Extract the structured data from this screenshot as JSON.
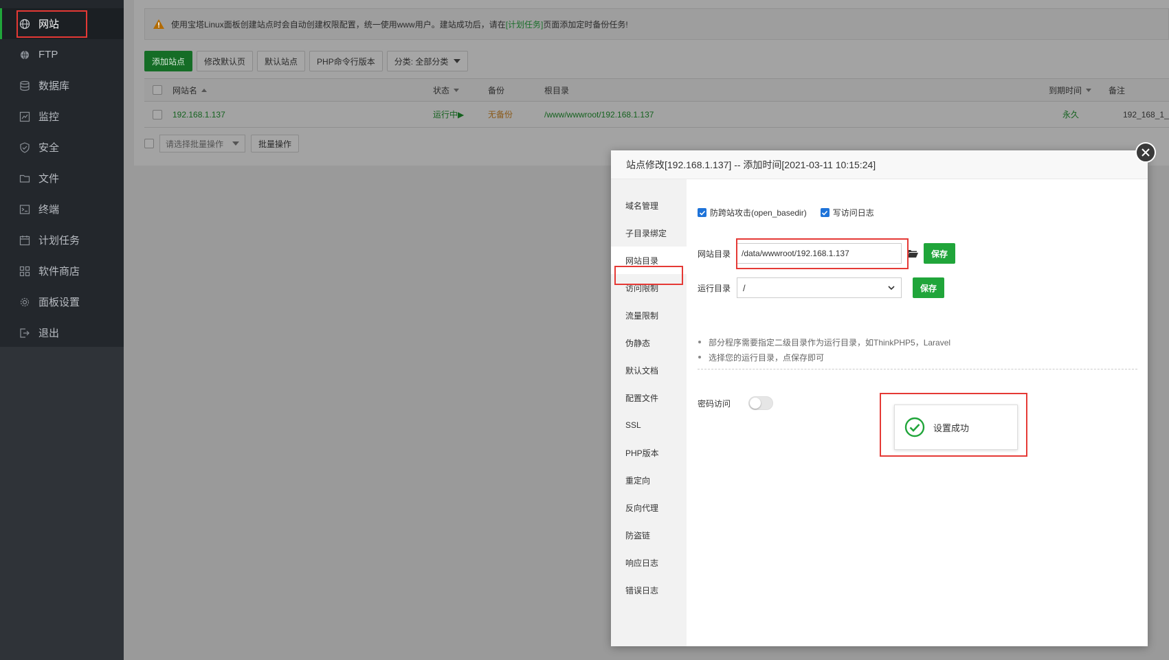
{
  "sidebar": {
    "items": [
      {
        "label": "网站",
        "icon": "globe-icon",
        "active": true
      },
      {
        "label": "FTP",
        "icon": "ftp-globe-icon"
      },
      {
        "label": "数据库",
        "icon": "database-icon"
      },
      {
        "label": "监控",
        "icon": "monitor-icon"
      },
      {
        "label": "安全",
        "icon": "shield-icon"
      },
      {
        "label": "文件",
        "icon": "folder-icon"
      },
      {
        "label": "终端",
        "icon": "terminal-icon"
      },
      {
        "label": "计划任务",
        "icon": "calendar-icon"
      },
      {
        "label": "软件商店",
        "icon": "grid-icon"
      },
      {
        "label": "面板设置",
        "icon": "gear-icon"
      },
      {
        "label": "退出",
        "icon": "logout-icon"
      }
    ]
  },
  "alert": {
    "text_before": "使用宝塔Linux面板创建站点时会自动创建权限配置，统一使用www用户。建站成功后，请在",
    "link": "[计划任务]",
    "text_after": "页面添加定时备份任务!"
  },
  "toolbar": {
    "add_site": "添加站点",
    "edit_default_page": "修改默认页",
    "default_site": "默认站点",
    "php_cli_version": "PHP命令行版本",
    "category": "分类: 全部分类"
  },
  "table": {
    "headers": {
      "site_name": "网站名",
      "status": "状态",
      "backup": "备份",
      "root_dir": "根目录",
      "expire": "到期时间",
      "remark": "备注"
    },
    "rows": [
      {
        "site_name": "192.168.1.137",
        "status": "运行中▶",
        "backup": "无备份",
        "root_dir": "/www/wwwroot/192.168.1.137",
        "expire": "永久",
        "remark": "192_168_1_"
      }
    ]
  },
  "batch": {
    "select_placeholder": "请选择批量操作",
    "button": "批量操作"
  },
  "modal": {
    "title": "站点修改[192.168.1.137] -- 添加时间[2021-03-11 10:15:24]",
    "tabs": [
      "域名管理",
      "子目录绑定",
      "网站目录",
      "访问限制",
      "流量限制",
      "伪静态",
      "默认文档",
      "配置文件",
      "SSL",
      "PHP版本",
      "重定向",
      "反向代理",
      "防盗链",
      "响应日志",
      "错误日志"
    ],
    "active_tab": "网站目录",
    "checks": {
      "open_basedir": "防跨站攻击(open_basedir)",
      "access_log": "写访问日志"
    },
    "site_dir_label": "网站目录",
    "site_dir_value": "/data/wwwroot/192.168.1.137",
    "run_dir_label": "运行目录",
    "run_dir_value": "/",
    "save_label": "保存",
    "tips": [
      "部分程序需要指定二级目录作为运行目录，如ThinkPHP5，Laravel",
      "选择您的运行目录，点保存即可"
    ],
    "password_access_label": "密码访问",
    "password_access_enabled": false,
    "toast": "设置成功"
  },
  "colors": {
    "accent": "#20a53a",
    "highlight": "#e53935",
    "checkbox": "#1e73d9"
  }
}
